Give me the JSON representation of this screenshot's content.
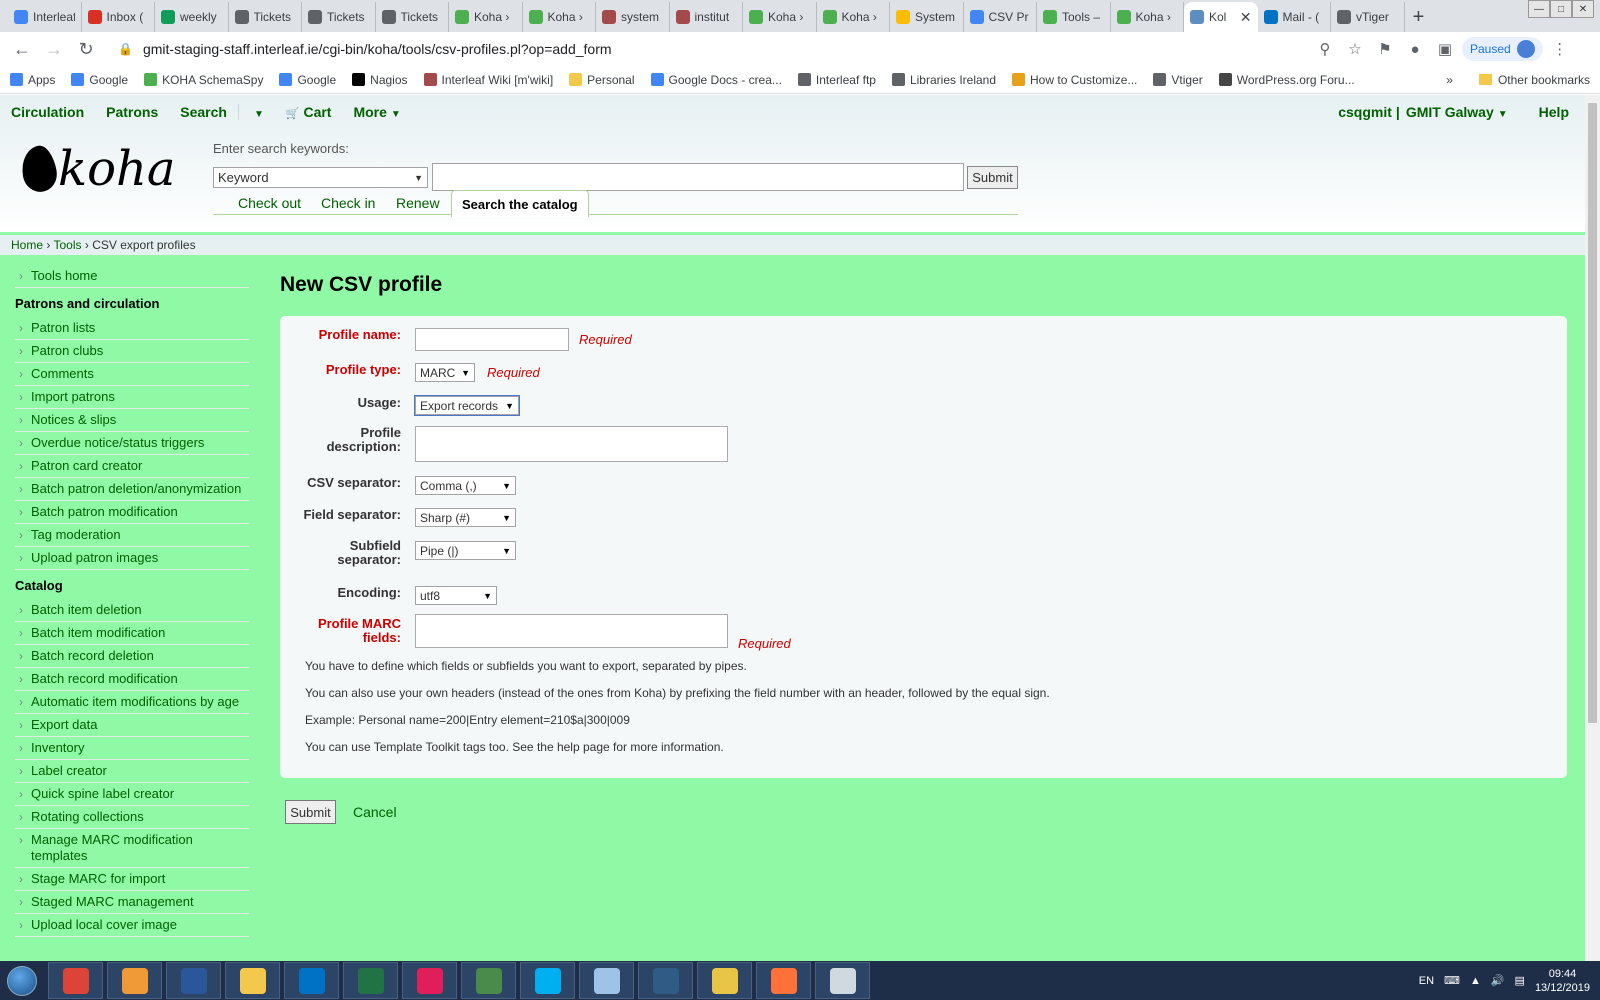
{
  "browser": {
    "tabs": [
      {
        "label": "Interleaf",
        "color": "#4285f4"
      },
      {
        "label": "Inbox (",
        "color": "#d93025"
      },
      {
        "label": "weekly",
        "color": "#0f9d58"
      },
      {
        "label": "Tickets",
        "color": "#5f6368"
      },
      {
        "label": "Tickets",
        "color": "#5f6368"
      },
      {
        "label": "Tickets",
        "color": "#5f6368"
      },
      {
        "label": "Koha ›",
        "color": "#4caf50"
      },
      {
        "label": "Koha ›",
        "color": "#4caf50"
      },
      {
        "label": "system",
        "color": "#a34a4a"
      },
      {
        "label": "institut",
        "color": "#a34a4a"
      },
      {
        "label": "Koha ›",
        "color": "#4caf50"
      },
      {
        "label": "Koha ›",
        "color": "#4caf50"
      },
      {
        "label": "System",
        "color": "#fbbc04"
      },
      {
        "label": "CSV Pr",
        "color": "#4285f4"
      },
      {
        "label": "Tools –",
        "color": "#4caf50"
      },
      {
        "label": "Koha ›",
        "color": "#4caf50"
      },
      {
        "label": "Kol",
        "color": "#5c8ec2",
        "active": true
      },
      {
        "label": "Mail - (",
        "color": "#0072c6"
      },
      {
        "label": "vTiger",
        "color": "#5f6368"
      }
    ],
    "new_tab": "+",
    "url": "gmit-staging-staff.interleaf.ie/cgi-bin/koha/tools/csv-profiles.pl?op=add_form",
    "paused_label": "Paused",
    "bookmarks": [
      {
        "label": "Apps",
        "color": "#4285f4"
      },
      {
        "label": "Google",
        "color": "#4285f4"
      },
      {
        "label": "KOHA SchemaSpy",
        "color": "#4caf50"
      },
      {
        "label": "Google",
        "color": "#4285f4"
      },
      {
        "label": "Nagios",
        "color": "#000000"
      },
      {
        "label": "Interleaf Wiki [m'wiki]",
        "color": "#a34a4a"
      },
      {
        "label": "Personal",
        "color": "#f2c94c"
      },
      {
        "label": "Google Docs - crea...",
        "color": "#4285f4"
      },
      {
        "label": "Interleaf ftp",
        "color": "#5f6368"
      },
      {
        "label": "Libraries Ireland",
        "color": "#5f6368"
      },
      {
        "label": "How to Customize...",
        "color": "#e3a21a"
      },
      {
        "label": "Vtiger",
        "color": "#5f6368"
      },
      {
        "label": "WordPress.org Foru...",
        "color": "#464646"
      }
    ],
    "other_bookmarks": "Other bookmarks"
  },
  "nav": {
    "circulation": "Circulation",
    "patrons": "Patrons",
    "search": "Search",
    "cart": "Cart",
    "more": "More",
    "user": "csqgmit",
    "branch": "GMIT Galway",
    "help": "Help"
  },
  "search": {
    "label": "Enter search keywords:",
    "type": "Keyword",
    "submit": "Submit",
    "tabs": {
      "checkout": "Check out",
      "checkin": "Check in",
      "renew": "Renew",
      "catalog": "Search the catalog"
    }
  },
  "logo_text": "koha",
  "breadcrumb": {
    "home": "Home",
    "tools": "Tools",
    "current": "CSV export profiles",
    "sep": "›"
  },
  "sidebar": {
    "tools_home": "Tools home",
    "patrons_heading": "Patrons and circulation",
    "patrons_items": [
      "Patron lists",
      "Patron clubs",
      "Comments",
      "Import patrons",
      "Notices & slips",
      "Overdue notice/status triggers",
      "Patron card creator",
      "Batch patron deletion/anonymization",
      "Batch patron modification",
      "Tag moderation",
      "Upload patron images"
    ],
    "catalog_heading": "Catalog",
    "catalog_items": [
      "Batch item deletion",
      "Batch item modification",
      "Batch record deletion",
      "Batch record modification",
      "Automatic item modifications by age",
      "Export data",
      "Inventory",
      "Label creator",
      "Quick spine label creator",
      "Rotating collections",
      "Manage MARC modification templates",
      "Stage MARC for import",
      "Staged MARC management",
      "Upload local cover image"
    ]
  },
  "form": {
    "title": "New CSV profile",
    "profile_name_label": "Profile name:",
    "profile_type_label": "Profile type:",
    "profile_type_value": "MARC",
    "usage_label": "Usage:",
    "usage_value": "Export records",
    "description_label": "Profile description:",
    "csv_separator_label": "CSV separator:",
    "csv_separator_value": "Comma (,)",
    "field_separator_label": "Field separator:",
    "field_separator_value": "Sharp (#)",
    "subfield_separator_label": "Subfield separator:",
    "subfield_separator_value": "Pipe (|)",
    "encoding_label": "Encoding:",
    "encoding_value": "utf8",
    "marc_fields_label": "Profile MARC fields:",
    "required": "Required",
    "help1": "You have to define which fields or subfields you want to export, separated by pipes.",
    "help2": "You can also use your own headers (instead of the ones from Koha) by prefixing the field number with an header, followed by the equal sign.",
    "help3": "Example: Personal name=200|Entry element=210$a|300|009",
    "help4": "You can use Template Toolkit tags too. See the help page for more information.",
    "submit": "Submit",
    "cancel": "Cancel"
  },
  "taskbar": {
    "apps": [
      {
        "name": "chrome",
        "color": "#db4437"
      },
      {
        "name": "media-player",
        "color": "#f09a37"
      },
      {
        "name": "word",
        "color": "#2b579a"
      },
      {
        "name": "explorer",
        "color": "#f2c94c"
      },
      {
        "name": "outlook",
        "color": "#0072c6"
      },
      {
        "name": "excel",
        "color": "#217346"
      },
      {
        "name": "slack",
        "color": "#e01e5a"
      },
      {
        "name": "remote-desktop",
        "color": "#4a8a4a"
      },
      {
        "name": "skype",
        "color": "#00aff0"
      },
      {
        "name": "notepad",
        "color": "#9ec3e6"
      },
      {
        "name": "mysql-workbench",
        "color": "#2f5b85"
      },
      {
        "name": "network-tool",
        "color": "#e8c547"
      },
      {
        "name": "firefox",
        "color": "#ff7139"
      },
      {
        "name": "font-viewer",
        "color": "#d0d8e0"
      }
    ],
    "lang": "EN",
    "time": "09:44",
    "date": "13/12/2019"
  }
}
